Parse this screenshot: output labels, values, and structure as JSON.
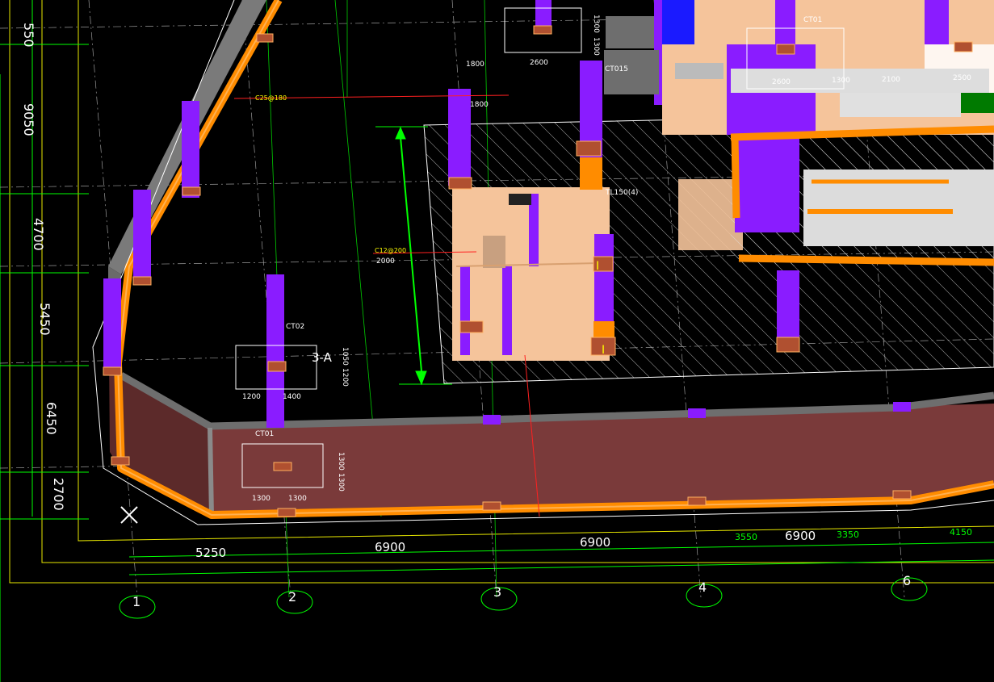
{
  "drawing": {
    "bottom_dims_white": [
      "5250",
      "6900",
      "6900",
      "6900"
    ],
    "bottom_dims_green": [
      "3550",
      "3350",
      "4150"
    ],
    "left_dims": [
      "550",
      "9050",
      "4700",
      "5450",
      "6450",
      "2700"
    ],
    "axis_labels": [
      "1",
      "2",
      "3",
      "4",
      "6"
    ],
    "labels": {
      "ct02": "CT02",
      "ct01_lower": "CT01",
      "ct015": "CT015",
      "ct01_upper": "CT01",
      "section_3a": "3-A",
      "slab_1": "C25@180",
      "slab_2": "C12@200",
      "slab_tag": "TL150(4)",
      "dim_2000": "2000",
      "dim_1800_top": "1800",
      "dim_2600_top": "2600",
      "dim_1800_mid": "1800",
      "dim_2600_r": "2600",
      "dim_1300_r": "1300",
      "dim_2100_r": "2100",
      "dim_2500_r": "2500",
      "dim_1200": "1200",
      "dim_1400": "1400",
      "dim_1300_a": "1300",
      "dim_1300_b": "1300",
      "dim_1300_v": "1300",
      "dim_1300_v2": "1300",
      "dim_1300_top_v": "1300",
      "dim_1300_top_v2": "1300",
      "dim_1050": "1050",
      "dim_1200_v": "1200"
    }
  },
  "colors": {
    "background": "#000000",
    "orange_beam": "#ff8c00",
    "purple_column": "#8a1cff",
    "pile_cap": "#f5c49b",
    "wall_fill": "#7a3a3a",
    "grid_green": "#00ff00",
    "grid_white": "#ffffff",
    "hatch": "#cfcfcf"
  }
}
